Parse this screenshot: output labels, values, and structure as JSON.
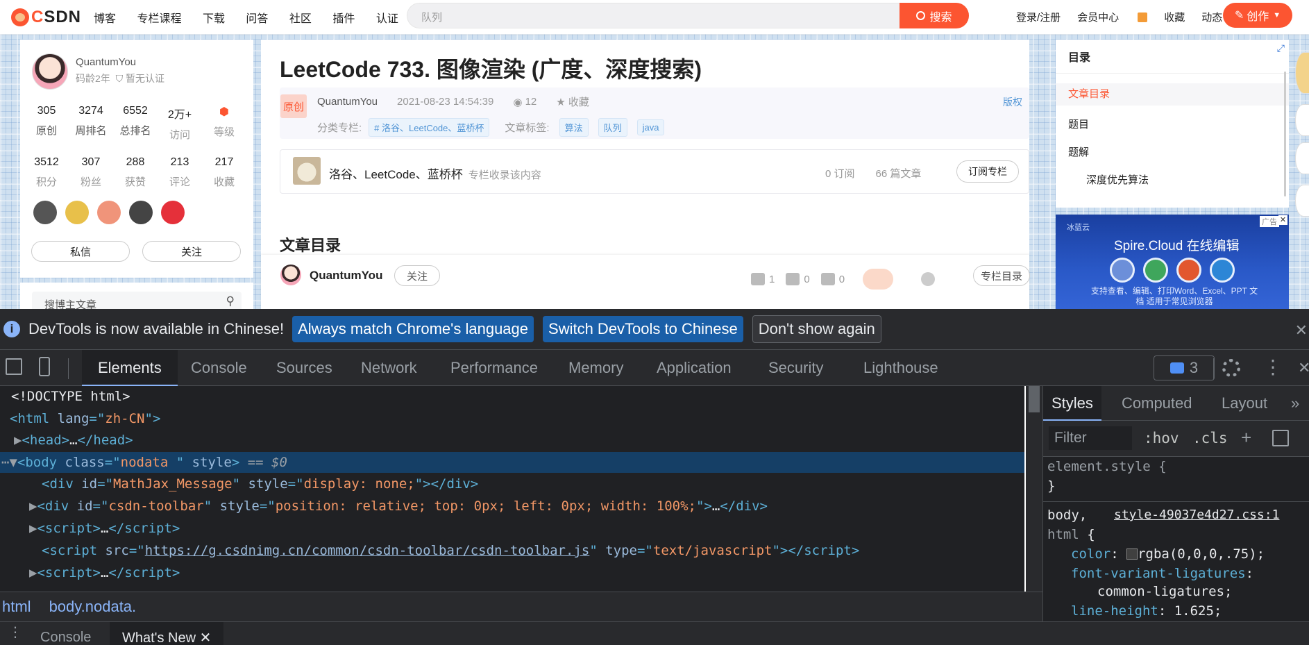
{
  "toolbar": {
    "logo_text": "CSDN",
    "nav": [
      "博客",
      "专栏课程",
      "下载",
      "问答",
      "社区",
      "插件",
      "认证"
    ],
    "search_placeholder": "队列",
    "search_button": "搜索",
    "right_links": [
      "登录/注册",
      "会员中心",
      "收藏",
      "动态"
    ],
    "create_button": "创作"
  },
  "profile": {
    "name": "QuantumYou",
    "years": "码龄2年",
    "verify": "暂无认证",
    "stats_row1": [
      {
        "value": "305",
        "label": "原创"
      },
      {
        "value": "3274",
        "label": "周排名"
      },
      {
        "value": "6552",
        "label": "总排名"
      },
      {
        "value": "2万+",
        "label": "访问"
      },
      {
        "value": "",
        "label": "等级"
      }
    ],
    "stats_row2": [
      {
        "value": "3512",
        "label": "积分"
      },
      {
        "value": "307",
        "label": "粉丝"
      },
      {
        "value": "288",
        "label": "获赞"
      },
      {
        "value": "213",
        "label": "评论"
      },
      {
        "value": "217",
        "label": "收藏"
      }
    ],
    "message_button": "私信",
    "follow_button": "关注",
    "search_placeholder": "搜博主文章"
  },
  "article": {
    "title": "LeetCode 733. 图像渲染 (广度、深度搜索)",
    "original_badge": "原创",
    "author": "QuantumYou",
    "datetime": "2021-08-23 14:54:39",
    "views": "12",
    "favorite": "收藏",
    "copyright": "版权",
    "category_label": "分类专栏:",
    "category_tag": "# 洛谷、LeetCode、蓝桥杯",
    "tags_label": "文章标签:",
    "tags": [
      "算法",
      "队列",
      "java"
    ],
    "column_name": "洛谷、LeetCode、蓝桥杯",
    "column_desc": "专栏收录该内容",
    "column_subs": "0 订阅",
    "column_articles": "66 篇文章",
    "subscribe_button": "订阅专栏",
    "toc_heading": "文章目录",
    "bar_author": "QuantumYou",
    "bar_follow": "关注",
    "likes": "1",
    "comments": "0",
    "stars": "0",
    "column_toc_button": "专栏目录"
  },
  "toc": {
    "title": "目录",
    "items": [
      "文章目录",
      "题目",
      "题解",
      "深度优先算法"
    ]
  },
  "ad": {
    "brand": "冰蓝云",
    "label": "广告",
    "headline": "Spire.Cloud 在线编辑",
    "desc": "支持查看、编辑、打印Word、Excel、PPT 文档 适用于常见浏览器"
  },
  "devtools": {
    "info_text": "DevTools is now available in Chinese!",
    "info_btn_match": "Always match Chrome's language",
    "info_btn_switch": "Switch DevTools to Chinese",
    "info_btn_dismiss": "Don't show again",
    "tabs": [
      "Elements",
      "Console",
      "Sources",
      "Network",
      "Performance",
      "Memory",
      "Application",
      "Security",
      "Lighthouse"
    ],
    "issues_count": "3",
    "breadcrumb": [
      "html",
      "body.nodata."
    ],
    "drawer_tabs": [
      "Console",
      "What's New"
    ],
    "styles_tabs": [
      "Styles",
      "Computed",
      "Layout"
    ],
    "filter_placeholder": "Filter",
    "hov": ":hov",
    "cls": ".cls",
    "styles": {
      "element_style": "element.style {",
      "close_brace": "}",
      "selector1": "body,",
      "source": "style-49037e4d27.css:1",
      "selector2": "html",
      "prop1": "color",
      "val1": "rgba(0,0,0,.75);",
      "prop2": "font-variant-ligatures",
      "val2": "common-ligatures;",
      "prop3": "line-height",
      "val3": "1.625;"
    },
    "dom": {
      "doctype": "<!DOCTYPE html>",
      "html_lang": "zh-CN",
      "body_class": "nodata ",
      "mathjax_id": "MathJax_Message",
      "mathjax_style": "display: none;",
      "toolbar_id": "csdn-toolbar",
      "toolbar_style": "position: relative; top: 0px; left: 0px; width: 100%;",
      "script_src": "https://g.csdnimg.cn/common/csdn-toolbar/csdn-toolbar.js",
      "script_type": "text/javascript",
      "eq": "== $0"
    }
  }
}
